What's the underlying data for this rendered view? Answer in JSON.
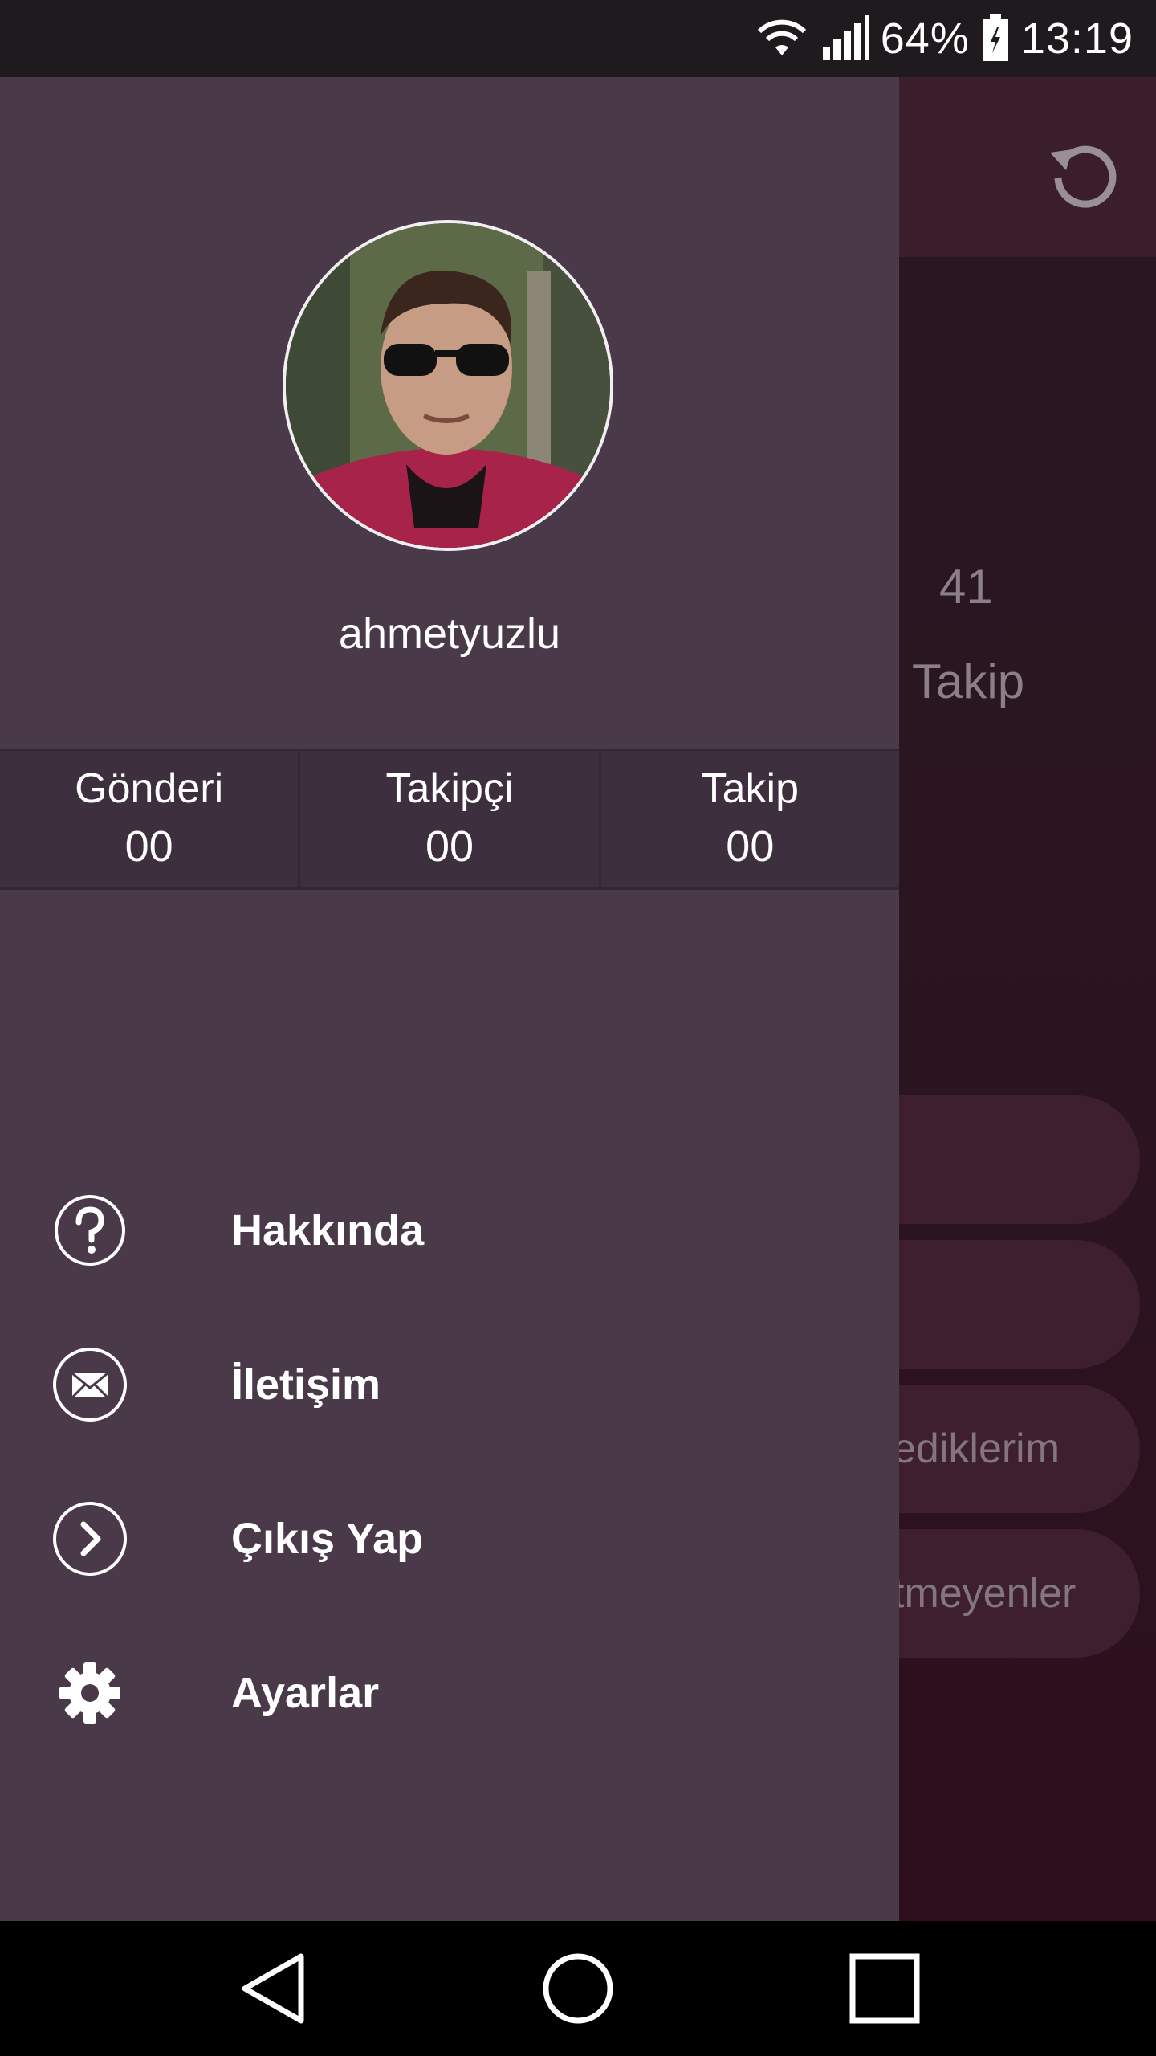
{
  "status_bar": {
    "battery_percent": "64%",
    "time": "13:19",
    "icons": [
      "wifi-icon",
      "signal-icon",
      "battery-icon"
    ]
  },
  "background": {
    "stat_value": "41",
    "stat_label": "Takip",
    "pill_1": "",
    "pill_2": "",
    "pill_3": "ediklerim",
    "pill_4": "tmeyenler",
    "refresh_icon": "refresh-icon"
  },
  "drawer": {
    "username": "ahmetyuzlu",
    "stats": [
      {
        "label": "Gönderi",
        "value": "00"
      },
      {
        "label": "Takipçi",
        "value": "00"
      },
      {
        "label": "Takip",
        "value": "00"
      }
    ],
    "menu": [
      {
        "label": "Hakkında",
        "icon": "help-icon"
      },
      {
        "label": "İletişim",
        "icon": "mail-icon"
      },
      {
        "label": "Çıkış Yap",
        "icon": "logout-icon"
      },
      {
        "label": "Ayarlar",
        "icon": "settings-icon"
      }
    ]
  },
  "nav_bar": {
    "icons": [
      "back-icon",
      "home-icon",
      "recents-icon"
    ]
  },
  "colors": {
    "drawer_bg": "#493949",
    "stats_bg": "#3d2f3d",
    "app_bg": "#2a1724",
    "text": "#ffffff"
  }
}
